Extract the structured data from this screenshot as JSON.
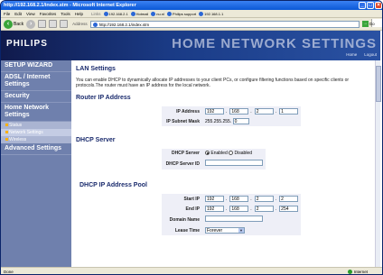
{
  "browser": {
    "title": "http://192.168.2.1/index.stm - Microsoft Internet Explorer",
    "menu": [
      "File",
      "Edit",
      "View",
      "Favorites",
      "Tools",
      "Help"
    ],
    "links_label": "Links",
    "links": [
      "192.168.2.1",
      "Hotmail",
      "nu.nl",
      "Philips support",
      "192.168.1.1"
    ],
    "back_label": "Back",
    "address_label": "Address",
    "address": "http://192.168.2.1/index.stm",
    "go_label": "Go",
    "status_left": "Done",
    "status_right": "Internet"
  },
  "header": {
    "brand": "PHILIPS",
    "title": "HOME NETWORK SETTINGS",
    "links": [
      "Home",
      "Logout"
    ]
  },
  "sidebar": {
    "items": [
      {
        "label": "SETUP WIZARD"
      },
      {
        "label": "ADSL / Internet Settings"
      },
      {
        "label": "Security"
      },
      {
        "label": "Home Network Settings"
      }
    ],
    "subitems": [
      "Status",
      "Network Settings",
      "Wireless"
    ],
    "last": "Advanced Settings"
  },
  "main": {
    "title": "LAN Settings",
    "description": "You can enable DHCP to dynamically allocate IP addresses to your client PCs, or configure filtering functions based on specific clients or protocols.The router must have an IP address for the local network.",
    "router": {
      "heading": "Router IP Address",
      "ip_label": "IP Address",
      "ip": [
        "192",
        "168",
        "2",
        "1"
      ],
      "mask_label": "IP Subnet Mask",
      "mask_prefix": "255.255.255.",
      "mask_last": "0"
    },
    "dhcp": {
      "heading": "DHCP Server",
      "server_label": "DHCP Server",
      "enabled_label": "Enabled",
      "disabled_label": "Disabled",
      "id_label": "DHCP Server ID",
      "id_value": ""
    },
    "pool": {
      "heading": "DHCP IP Address Pool",
      "start_label": "Start IP",
      "start": [
        "192",
        "168",
        "2",
        "2"
      ],
      "end_label": "End IP",
      "end": [
        "192",
        "168",
        "2",
        "254"
      ],
      "domain_label": "Domain Name",
      "domain_value": "",
      "lease_label": "Lease Time",
      "lease_value": "Forever"
    }
  }
}
